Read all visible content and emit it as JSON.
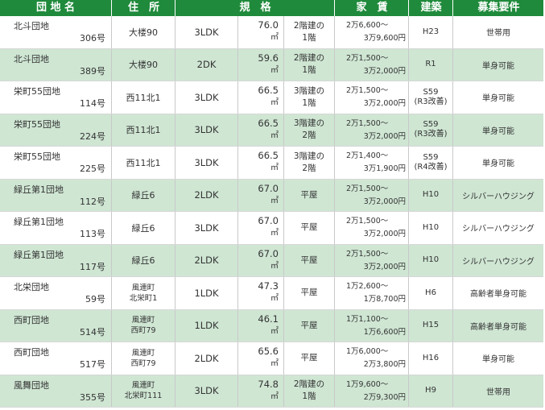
{
  "header": {
    "name": "団 地 名",
    "address": "住　所",
    "spec": "規　格",
    "rent": "家　賃",
    "built": "建築",
    "requirement": "募集要件"
  },
  "area_unit": "㎡",
  "colors": {
    "header_bg": "#1f8a3b",
    "alt_row_bg": "#cfe6d3"
  },
  "rows": [
    {
      "name": "北斗団地",
      "no": "306号",
      "address": [
        "大楼90"
      ],
      "type": "3LDK",
      "area": "76.0",
      "floor": [
        "2階建の",
        "1階"
      ],
      "rent": [
        "2万6,600～",
        "3万9,600円"
      ],
      "built": [
        "H23"
      ],
      "requirement": "世帯用"
    },
    {
      "name": "北斗団地",
      "no": "389号",
      "address": [
        "大楼90"
      ],
      "type": "2DK",
      "area": "59.6",
      "floor": [
        "2階建の",
        "1階"
      ],
      "rent": [
        "2万1,500～",
        "3万2,000円"
      ],
      "built": [
        "R1"
      ],
      "requirement": "単身可能"
    },
    {
      "name": "栄町55団地",
      "no": "114号",
      "address": [
        "西11北1"
      ],
      "type": "3LDK",
      "area": "66.5",
      "floor": [
        "3階建の",
        "1階"
      ],
      "rent": [
        "2万1,500～",
        "3万2,000円"
      ],
      "built": [
        "S59",
        "(R3改善)"
      ],
      "requirement": "単身可能"
    },
    {
      "name": "栄町55団地",
      "no": "224号",
      "address": [
        "西11北1"
      ],
      "type": "3LDK",
      "area": "66.5",
      "floor": [
        "3階建の",
        "2階"
      ],
      "rent": [
        "2万1,500～",
        "3万2,000円"
      ],
      "built": [
        "S59",
        "(R3改善)"
      ],
      "requirement": "単身可能"
    },
    {
      "name": "栄町55団地",
      "no": "225号",
      "address": [
        "西11北1"
      ],
      "type": "3LDK",
      "area": "66.5",
      "floor": [
        "3階建の",
        "2階"
      ],
      "rent": [
        "2万1,400～",
        "3万1,900円"
      ],
      "built": [
        "S59",
        "(R4改善)"
      ],
      "requirement": "単身可能"
    },
    {
      "name": "緑丘第1団地",
      "no": "112号",
      "address": [
        "緑丘6"
      ],
      "type": "2LDK",
      "area": "67.0",
      "floor": [
        "平屋"
      ],
      "rent": [
        "2万1,500～",
        "3万2,000円"
      ],
      "built": [
        "H10"
      ],
      "requirement": "シルバーハウジング"
    },
    {
      "name": "緑丘第1団地",
      "no": "113号",
      "address": [
        "緑丘6"
      ],
      "type": "3LDK",
      "area": "67.0",
      "floor": [
        "平屋"
      ],
      "rent": [
        "2万1,500～",
        "3万2,000円"
      ],
      "built": [
        "H10"
      ],
      "requirement": "シルバーハウジング"
    },
    {
      "name": "緑丘第1団地",
      "no": "117号",
      "address": [
        "緑丘6"
      ],
      "type": "2LDK",
      "area": "67.0",
      "floor": [
        "平屋"
      ],
      "rent": [
        "2万1,500～",
        "3万2,000円"
      ],
      "built": [
        "H10"
      ],
      "requirement": "シルバーハウジング"
    },
    {
      "name": "北栄団地",
      "no": "59号",
      "address": [
        "風連町",
        "北栄町1"
      ],
      "type": "1LDK",
      "area": "47.3",
      "floor": [
        "平屋"
      ],
      "rent": [
        "1万2,600～",
        "1万8,700円"
      ],
      "built": [
        "H6"
      ],
      "requirement": "高齢者単身可能"
    },
    {
      "name": "西町団地",
      "no": "514号",
      "address": [
        "風連町",
        "西町79"
      ],
      "type": "1LDK",
      "area": "46.1",
      "floor": [
        "平屋"
      ],
      "rent": [
        "1万1,100～",
        "1万6,600円"
      ],
      "built": [
        "H15"
      ],
      "requirement": "高齢者単身可能"
    },
    {
      "name": "西町団地",
      "no": "517号",
      "address": [
        "風連町",
        "西町79"
      ],
      "type": "2LDK",
      "area": "65.6",
      "floor": [
        "平屋"
      ],
      "rent": [
        "1万6,000～",
        "2万3,800円"
      ],
      "built": [
        "H16"
      ],
      "requirement": "単身可能"
    },
    {
      "name": "風舞団地",
      "no": "355号",
      "address": [
        "風連町",
        "北栄町111"
      ],
      "type": "3LDK",
      "area": "74.8",
      "floor": [
        "2階建の",
        "1階"
      ],
      "rent": [
        "1万9,600～",
        "2万9,300円"
      ],
      "built": [
        "H9"
      ],
      "requirement": "世帯用"
    }
  ]
}
